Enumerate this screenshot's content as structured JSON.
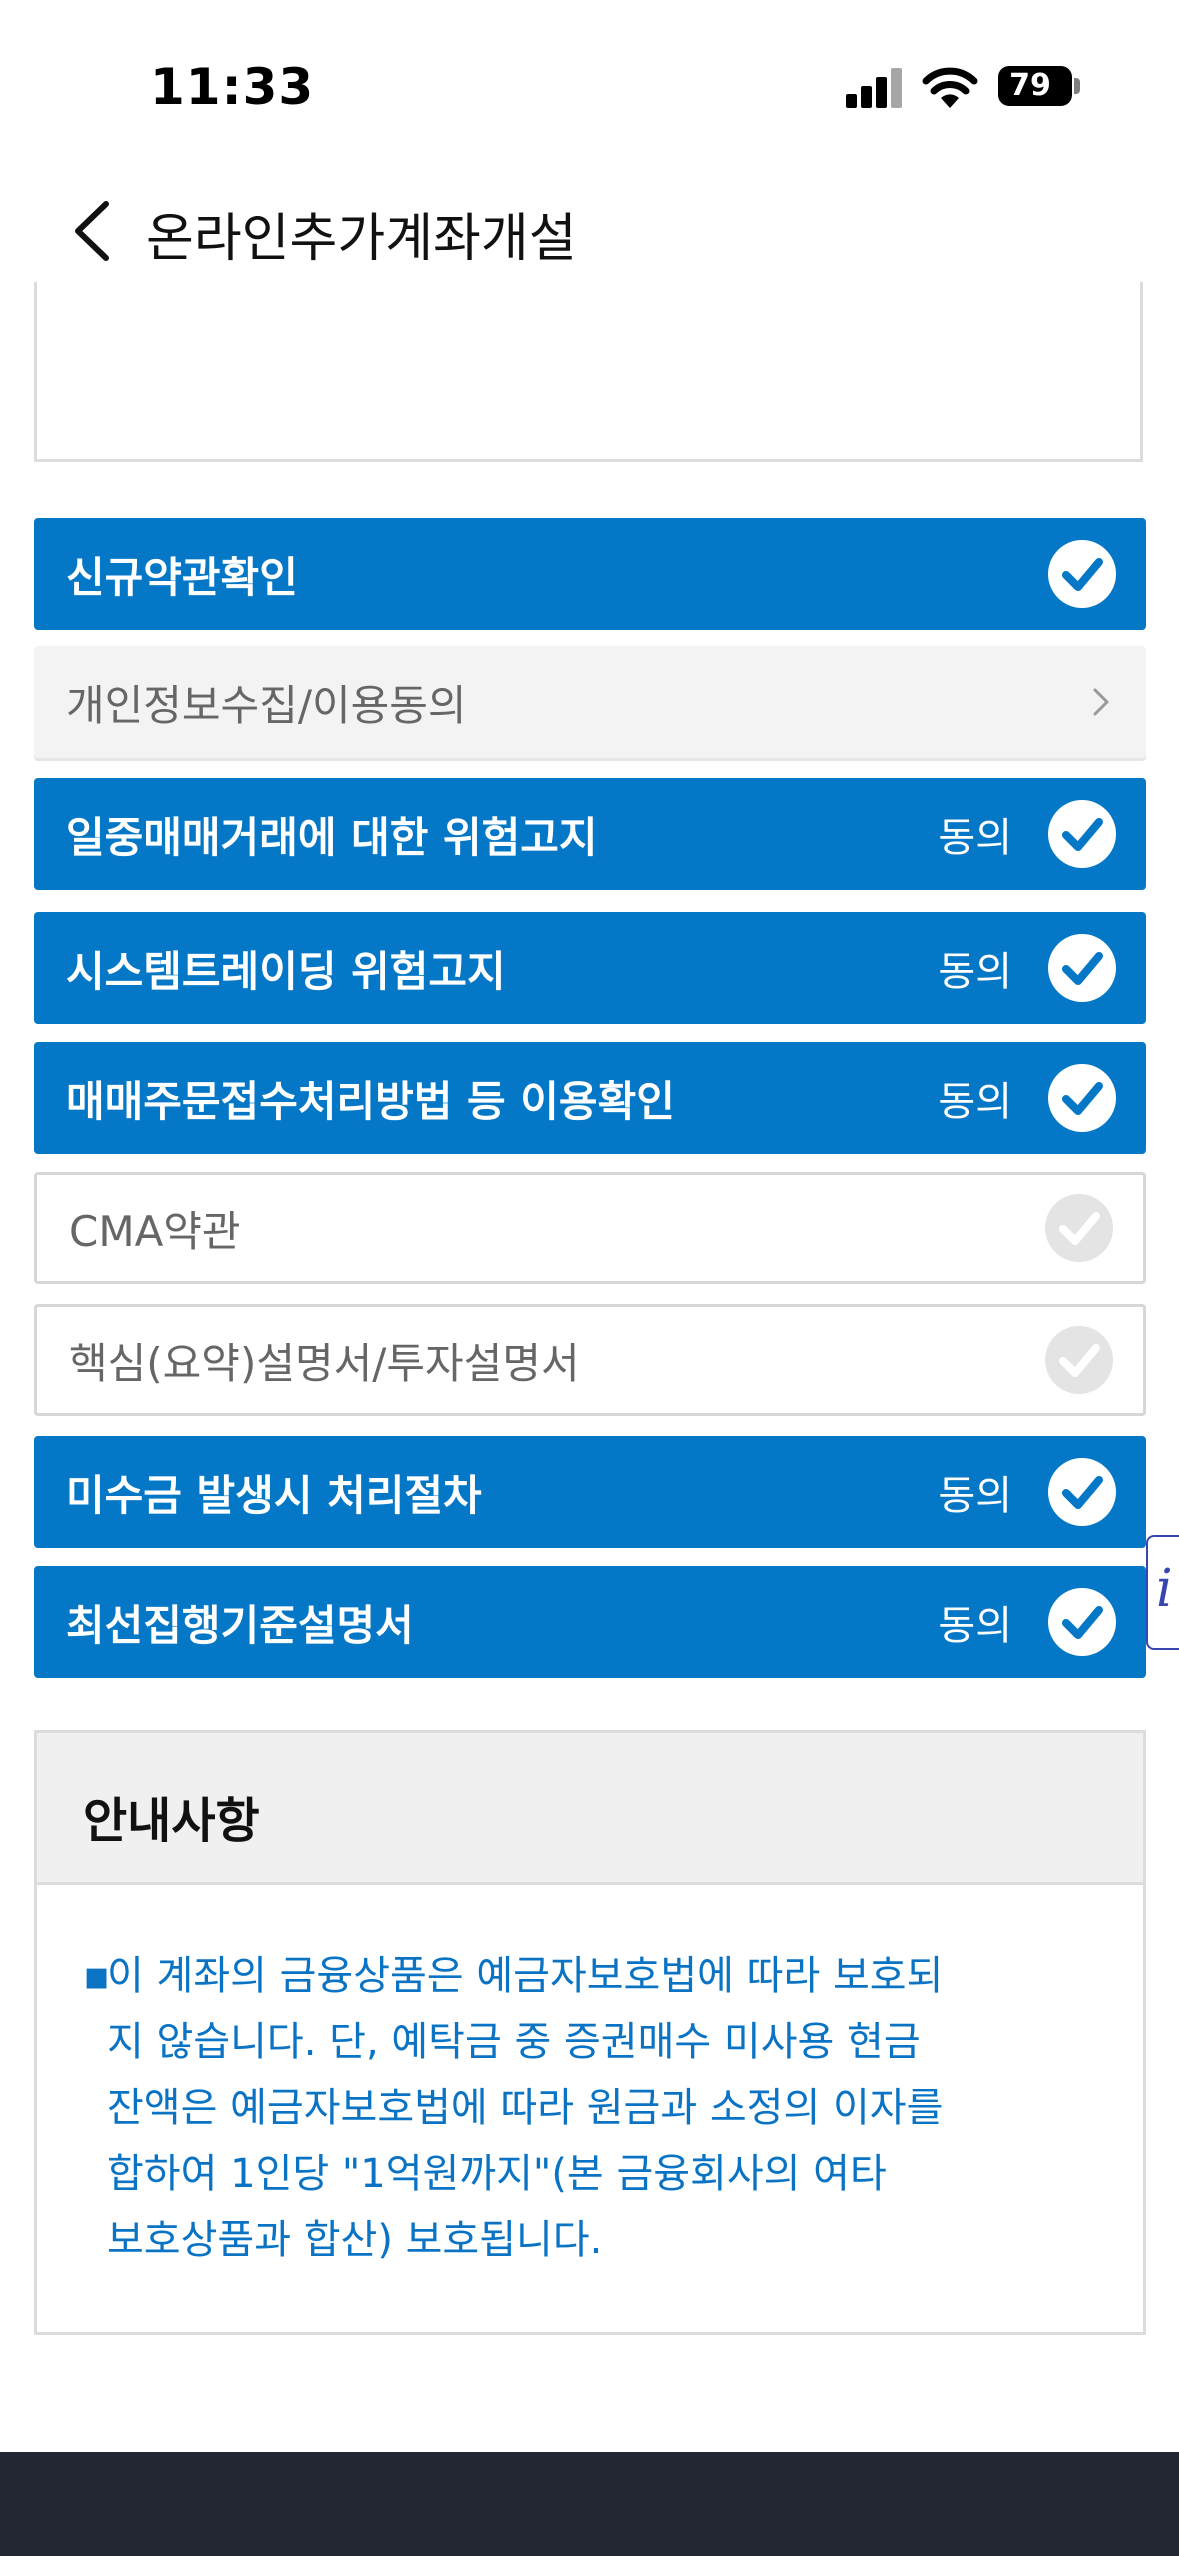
{
  "status_bar": {
    "time": "11:33",
    "battery": "79"
  },
  "header": {
    "title": "온라인추가계좌개설"
  },
  "rows": [
    {
      "label": "신규약관확인",
      "agree": "",
      "state": "checked"
    },
    {
      "label": "개인정보수집/이용동의",
      "agree": "",
      "state": "link"
    },
    {
      "label": "일중매매거래에 대한 위험고지",
      "agree": "동의",
      "state": "checked"
    },
    {
      "label": "시스템트레이딩 위험고지",
      "agree": "동의",
      "state": "checked"
    },
    {
      "label": "매매주문접수처리방법 등 이용확인",
      "agree": "동의",
      "state": "checked"
    },
    {
      "label": "CMA약관",
      "agree": "",
      "state": "unchecked"
    },
    {
      "label": "핵심(요약)설명서/투자설명서",
      "agree": "",
      "state": "unchecked"
    },
    {
      "label": "미수금 발생시 처리절차",
      "agree": "동의",
      "state": "checked"
    },
    {
      "label": "최선집행기준설명서",
      "agree": "동의",
      "state": "checked"
    }
  ],
  "info_tab": {
    "label": "i"
  },
  "notice": {
    "title": "안내사항",
    "bullet": "▪",
    "lines": [
      "이 계좌의 금융상품은 예금자보호법에 따라 보호되",
      "지 않습니다. 단, 예탁금 중 증권매수 미사용 현금",
      "잔액은 예금자보호법에 따라 원금과 소정의 이자를",
      "합하여 1인당 \"1억원까지\"(본 금융회사의 여타",
      "보호상품과 합산) 보호됩니다."
    ]
  }
}
